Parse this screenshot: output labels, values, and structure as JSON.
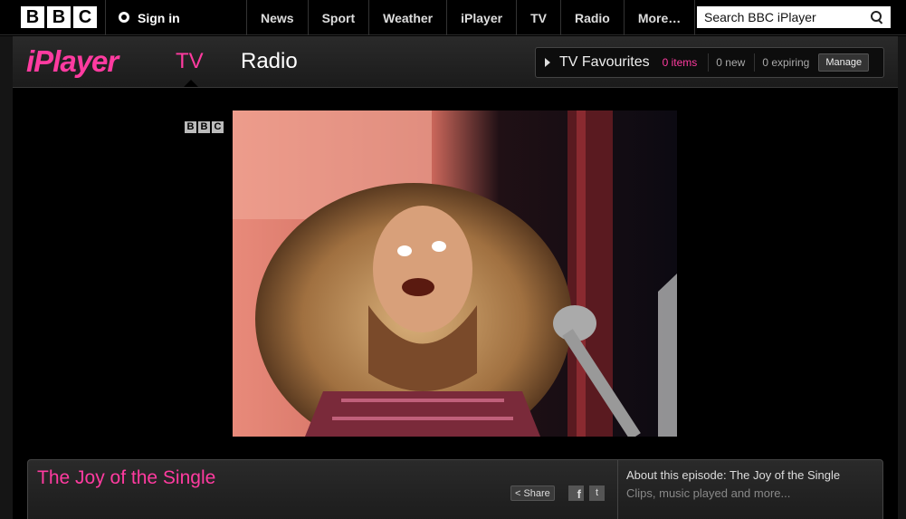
{
  "topbar": {
    "logo_letters": [
      "B",
      "B",
      "C"
    ],
    "signin_label": "Sign in",
    "nav": [
      "News",
      "Sport",
      "Weather",
      "iPlayer",
      "TV",
      "Radio",
      "More…"
    ],
    "search_placeholder": "Search BBC iPlayer"
  },
  "iplayer": {
    "logo": "iPlayer",
    "tabs": [
      {
        "label": "TV",
        "active": true
      },
      {
        "label": "Radio",
        "active": false
      }
    ],
    "favourites": {
      "title": "TV Favourites",
      "items": "0 items",
      "new": "0 new",
      "expiring": "0 expiring",
      "manage_label": "Manage"
    }
  },
  "video": {
    "watermark_letters": [
      "B",
      "B",
      "C"
    ]
  },
  "episode": {
    "title": "The Joy of the Single",
    "share_label": "Share",
    "facebook_icon": "f",
    "twitter_icon": "t",
    "about_title": "About this episode: The Joy of the Single",
    "about_sub": "Clips, music played and more..."
  },
  "colors": {
    "accent": "#ff3ba0",
    "background": "#000000"
  }
}
